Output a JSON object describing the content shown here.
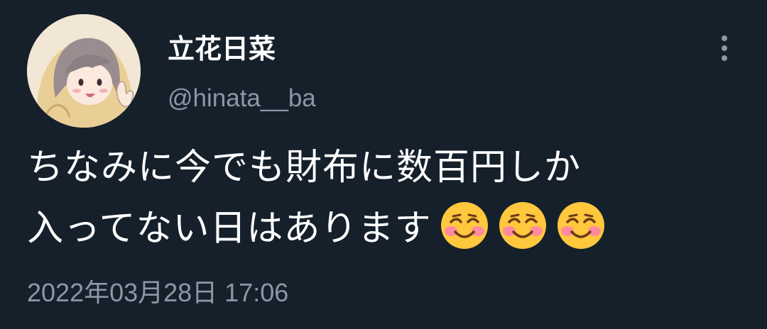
{
  "tweet": {
    "author": {
      "display_name": "立花日菜",
      "handle": "@hinata__ba",
      "avatar": "anime-girl-avatar"
    },
    "more_icon": "more-vertical-icon",
    "text_lines": [
      "ちなみに今でも財布に数百円しか",
      "入ってない日はあります"
    ],
    "emojis": [
      "smiling-face-emoji",
      "smiling-face-emoji",
      "smiling-face-emoji"
    ],
    "timestamp": "2022年03月28日 17:06"
  },
  "colors": {
    "background": "#15202b",
    "primary_text": "#ffffff",
    "secondary_text": "#8b98a5",
    "emoji_face": "#ffc83d",
    "emoji_blush": "#ff8aa0"
  }
}
